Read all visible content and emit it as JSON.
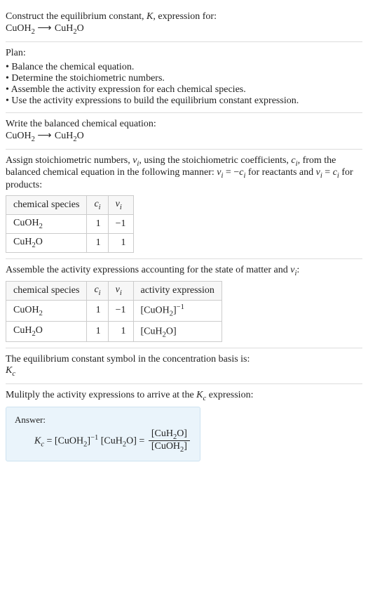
{
  "prompt_lines": {
    "l1_a": "Construct the equilibrium constant, ",
    "l1_k": "K",
    "l1_b": ", expression for:"
  },
  "equation": {
    "lhs": "CuOH",
    "lhs_sub": "2",
    "arrow": "⟶",
    "rhs_a": "CuH",
    "rhs_sub": "2",
    "rhs_b": "O"
  },
  "plan_label": "Plan:",
  "plan_items": [
    "Balance the chemical equation.",
    "Determine the stoichiometric numbers.",
    "Assemble the activity expression for each chemical species.",
    "Use the activity expressions to build the equilibrium constant expression."
  ],
  "balanced_label": "Write the balanced chemical equation:",
  "assign_text": {
    "a": "Assign stoichiometric numbers, ",
    "b": ", using the stoichiometric coefficients, ",
    "c": ", from the balanced chemical equation in the following manner: ",
    "d": " for reactants and ",
    "e": " for products:"
  },
  "vars": {
    "nu": "ν",
    "c": "c",
    "i": "i"
  },
  "rel_reactants_lhs": "ν",
  "rel_reactants_eq": " = −",
  "rel_reactants_rhs": "c",
  "rel_products_lhs": "ν",
  "rel_products_eq": " = ",
  "rel_products_rhs": "c",
  "table1": {
    "headers": {
      "species": "chemical species"
    },
    "rows": [
      {
        "species_a": "CuOH",
        "species_sub": "2",
        "species_b": "",
        "c": "1",
        "nu": "−1"
      },
      {
        "species_a": "CuH",
        "species_sub": "2",
        "species_b": "O",
        "c": "1",
        "nu": "1"
      }
    ]
  },
  "assemble_text": {
    "a": "Assemble the activity expressions accounting for the state of matter and ",
    "b": ":"
  },
  "table2": {
    "headers": {
      "species": "chemical species",
      "activity": "activity expression"
    },
    "rows": [
      {
        "species_a": "CuOH",
        "species_sub": "2",
        "species_b": "",
        "c": "1",
        "nu": "−1",
        "act_a": "[CuOH",
        "act_sub": "2",
        "act_b": "]",
        "act_sup": "−1"
      },
      {
        "species_a": "CuH",
        "species_sub": "2",
        "species_b": "O",
        "c": "1",
        "nu": "1",
        "act_a": "[CuH",
        "act_sub": "2",
        "act_b": "O]",
        "act_sup": ""
      }
    ]
  },
  "kc_symbol_text": "The equilibrium constant symbol in the concentration basis is:",
  "kc": {
    "K": "K",
    "c": "c"
  },
  "multiply_text": {
    "a": "Mulitply the activity expressions to arrive at the ",
    "b": " expression:"
  },
  "answer_label": "Answer:",
  "answer": {
    "eq1": " = ",
    "term1_a": "[CuOH",
    "term1_sub": "2",
    "term1_b": "]",
    "term1_sup": "−1",
    "sp": " ",
    "term2_a": "[CuH",
    "term2_sub": "2",
    "term2_b": "O]",
    "eq2": " = ",
    "num_a": "[CuH",
    "num_sub": "2",
    "num_b": "O]",
    "den_a": "[CuOH",
    "den_sub": "2",
    "den_b": "]"
  }
}
